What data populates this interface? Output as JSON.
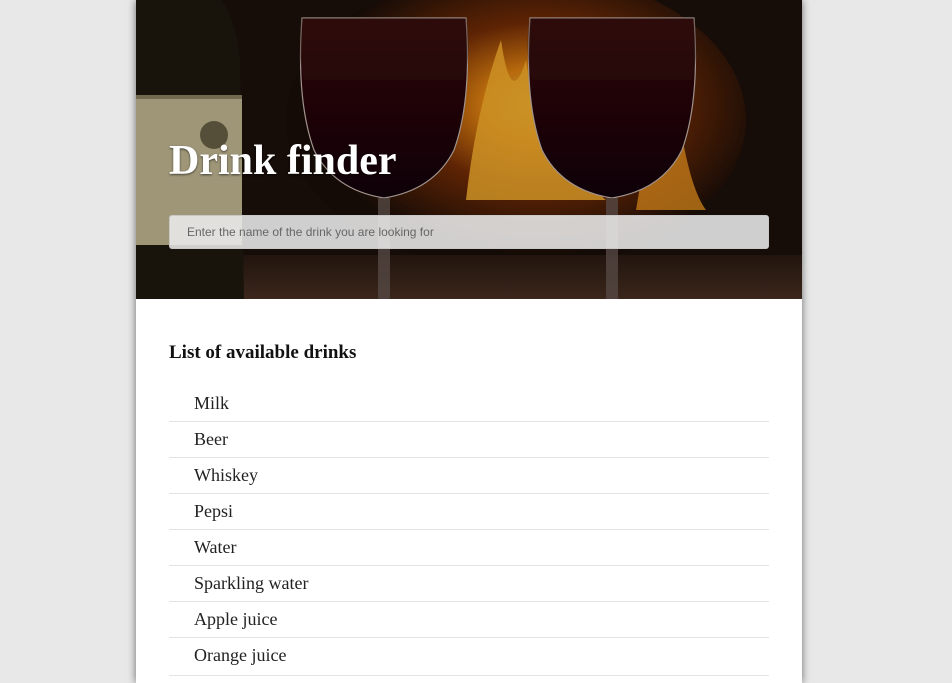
{
  "header": {
    "title": "Drink finder",
    "search_placeholder": "Enter the name of the drink you are looking for",
    "background_image": "wine-glasses-by-fireplace"
  },
  "main": {
    "list_heading": "List of available drinks",
    "drinks": [
      "Milk",
      "Beer",
      "Whiskey",
      "Pepsi",
      "Water",
      "Sparkling water",
      "Apple juice",
      "Orange juice"
    ]
  },
  "colors": {
    "page_background": "#e8e8e8",
    "card_background": "#ffffff",
    "title_color": "#ffffff",
    "divider": "#e4e4e4"
  }
}
